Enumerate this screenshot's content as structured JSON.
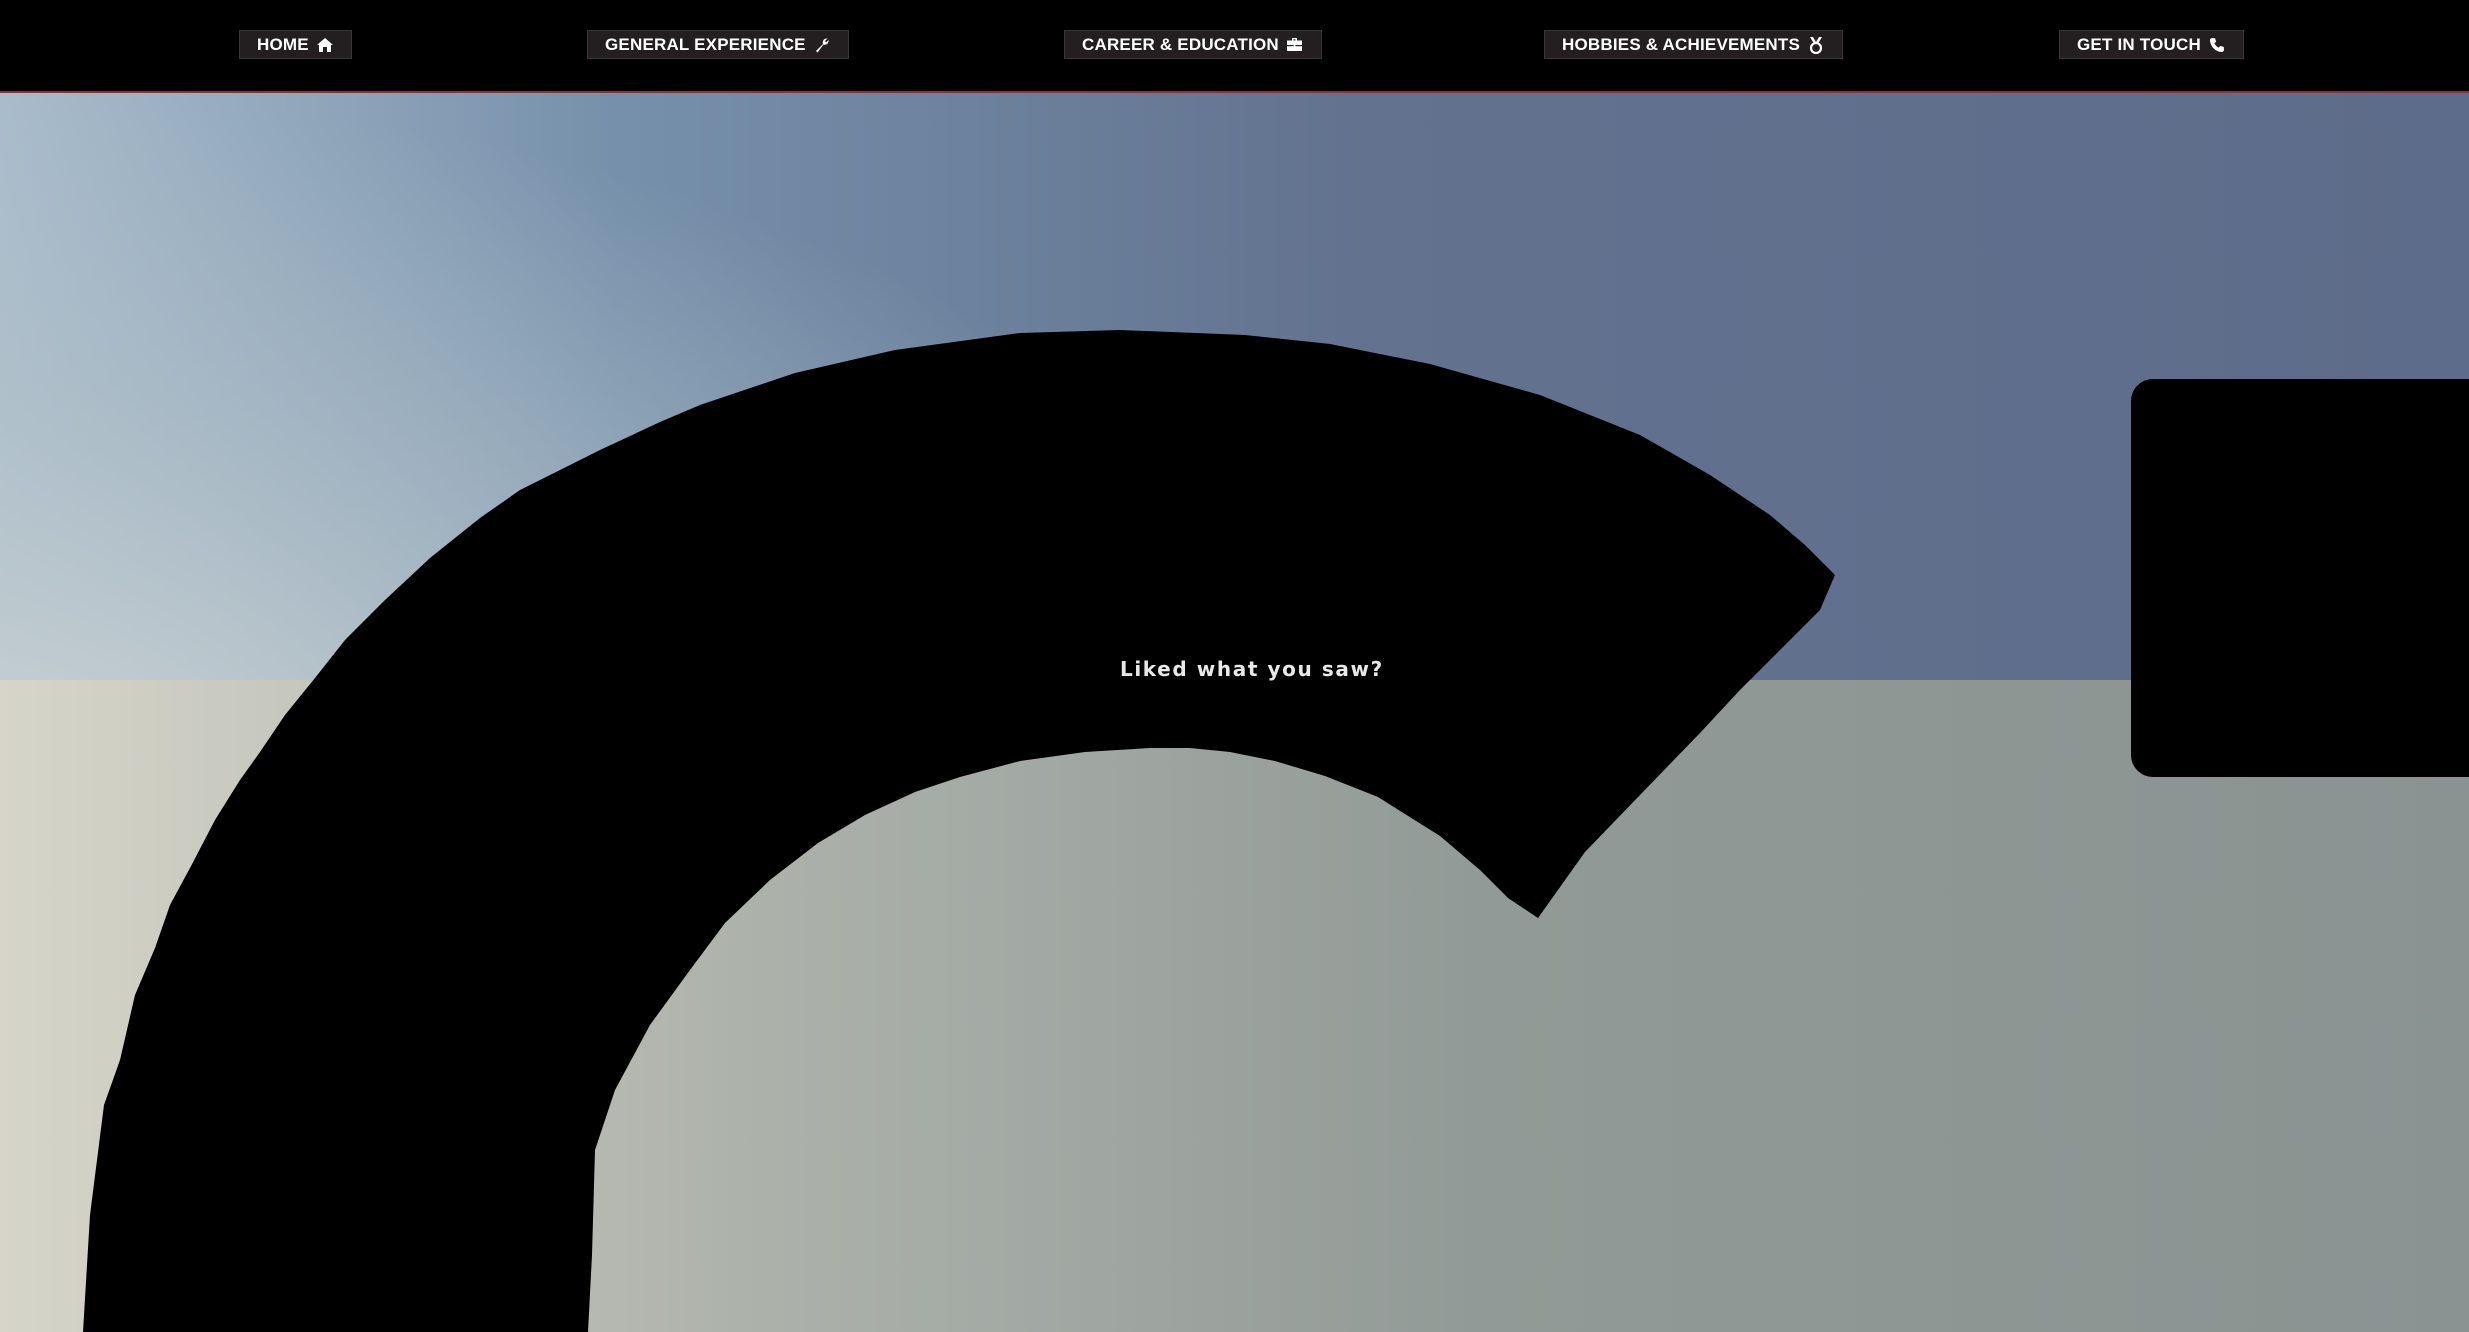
{
  "nav": {
    "items": [
      {
        "label": "HOME",
        "icon": "home-icon"
      },
      {
        "label": "GENERAL EXPERIENCE",
        "icon": "wrench-icon"
      },
      {
        "label": "CAREER & EDUCATION",
        "icon": "briefcase-icon"
      },
      {
        "label": "HOBBIES & ACHIEVEMENTS",
        "icon": "medal-icon"
      },
      {
        "label": "GET IN TOUCH",
        "icon": "phone-icon"
      }
    ],
    "accent_color": "#8e2f39",
    "bar_color": "#000000",
    "button_color": "#231f20"
  },
  "main": {
    "prompt": "Liked what you saw?"
  },
  "colors": {
    "sky_top": "#5f6f8a",
    "sky_left": "#c9d4d8",
    "ground": "#8c9593",
    "shape": "#000000"
  }
}
